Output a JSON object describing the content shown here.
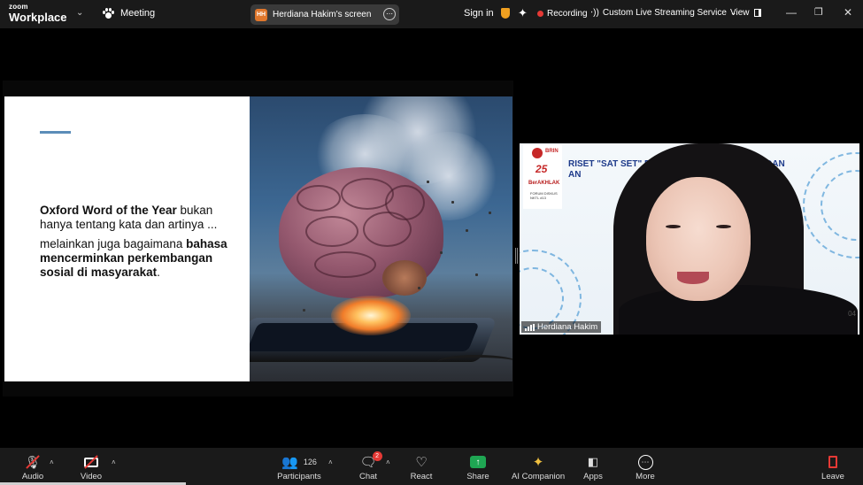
{
  "app": {
    "logo_line1": "zoom",
    "logo_line2": "Workplace",
    "meeting_label": "Meeting",
    "screen_label": "Herdiana Hakim's screen",
    "screen_avatar": "HH",
    "sign_in": "Sign in",
    "recording": "Recording",
    "streaming": "Custom Live Streaming Service",
    "view": "View",
    "accent_color": "#1fa653",
    "recording_color": "#e53935"
  },
  "slide": {
    "line1_bold": "Oxford Word of the Year",
    "line1_rest": " bukan hanya tentang kata dan artinya ...",
    "line2_start": "melainkan juga bagaimana ",
    "line2_bold": "bahasa mencerminkan perkembangan sosial di masyarakat",
    "line2_end": "."
  },
  "video_tile": {
    "participant_name": "Herdiana Hakim",
    "title_line1": "RISET \"SAT SET\" D                  AN BUATAN (AI) DAN",
    "title_line2": "AN                                        (AWK)",
    "logo_brin": "BRIN",
    "logo_25": "25",
    "logo_berakhlak": "BerAKHLAK",
    "logo_forum": "FORUM DISKUS",
    "logo_forum_no": "NKTL #13",
    "slide_number": "04"
  },
  "toolbar": {
    "audio": "Audio",
    "video": "Video",
    "participants": "Participants",
    "participants_count": "126",
    "chat": "Chat",
    "chat_badge": "2",
    "react": "React",
    "share": "Share",
    "ai_companion": "AI Companion",
    "apps": "Apps",
    "more": "More",
    "leave": "Leave"
  }
}
